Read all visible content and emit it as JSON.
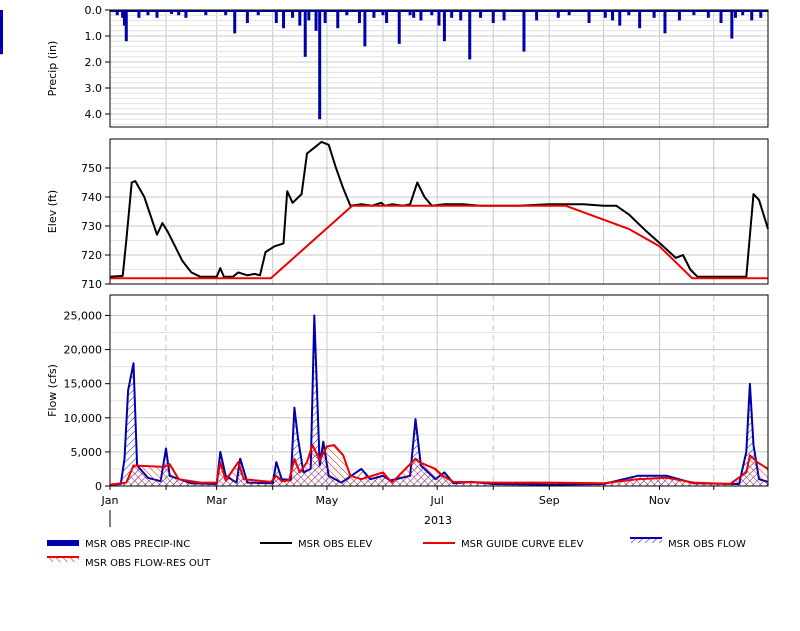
{
  "chart_data": [
    {
      "type": "bar",
      "ylabel": "Precip (in)",
      "ylim": [
        0,
        4.5
      ],
      "y_inverted": true,
      "yticks": [
        "0.0",
        "1.0",
        "2.0",
        "3.0",
        "4.0"
      ],
      "grid": true,
      "color": "#0000aa",
      "series_name": "MSR OBS PRECIP-INC",
      "x": [
        "2013-01-05",
        "2013-01-08",
        "2013-01-09",
        "2013-01-10",
        "2013-01-17",
        "2013-01-22",
        "2013-01-27",
        "2013-02-04",
        "2013-02-08",
        "2013-02-12",
        "2013-02-23",
        "2013-03-06",
        "2013-03-11",
        "2013-03-18",
        "2013-03-24",
        "2013-04-03",
        "2013-04-07",
        "2013-04-12",
        "2013-04-16",
        "2013-04-19",
        "2013-04-21",
        "2013-04-25",
        "2013-04-27",
        "2013-04-30",
        "2013-05-07",
        "2013-05-12",
        "2013-05-19",
        "2013-05-22",
        "2013-05-27",
        "2013-06-01",
        "2013-06-03",
        "2013-06-10",
        "2013-06-16",
        "2013-06-18",
        "2013-06-22",
        "2013-06-28",
        "2013-07-02",
        "2013-07-05",
        "2013-07-09",
        "2013-07-14",
        "2013-07-19",
        "2013-07-25",
        "2013-08-01",
        "2013-08-07",
        "2013-08-18",
        "2013-08-25",
        "2013-09-06",
        "2013-09-12",
        "2013-09-23",
        "2013-10-02",
        "2013-10-06",
        "2013-10-10",
        "2013-10-15",
        "2013-10-21",
        "2013-10-29",
        "2013-11-04",
        "2013-11-12",
        "2013-11-20",
        "2013-11-28",
        "2013-12-05",
        "2013-12-11",
        "2013-12-13",
        "2013-12-17",
        "2013-12-22",
        "2013-12-27"
      ],
      "values": [
        0.2,
        0.3,
        0.6,
        1.2,
        0.3,
        0.2,
        0.3,
        0.15,
        0.2,
        0.3,
        0.2,
        0.2,
        0.9,
        0.5,
        0.2,
        0.5,
        0.7,
        0.3,
        0.6,
        1.8,
        0.4,
        0.8,
        4.2,
        0.5,
        0.7,
        0.2,
        0.5,
        1.4,
        0.3,
        0.2,
        0.5,
        1.3,
        0.2,
        0.3,
        0.4,
        0.2,
        0.6,
        1.2,
        0.3,
        0.4,
        1.9,
        0.3,
        0.5,
        0.4,
        1.6,
        0.4,
        0.3,
        0.2,
        0.5,
        0.3,
        0.4,
        0.6,
        0.2,
        0.7,
        0.3,
        0.9,
        0.4,
        0.2,
        0.3,
        0.5,
        1.1,
        0.3,
        0.2,
        0.4,
        0.3,
        0.2,
        0.3,
        0.2,
        0.2,
        1.7,
        0.3,
        0.2
      ]
    },
    {
      "type": "line",
      "ylabel": "Elev (ft)",
      "ylim": [
        710,
        760
      ],
      "yticks": [
        "710",
        "720",
        "730",
        "740",
        "750"
      ],
      "grid": true,
      "series": [
        {
          "name": "MSR OBS ELEV",
          "color": "#000000",
          "points": [
            [
              "2013-01-01",
              712.5
            ],
            [
              "2013-01-08",
              712.8
            ],
            [
              "2013-01-10",
              725
            ],
            [
              "2013-01-13",
              745
            ],
            [
              "2013-01-15",
              745.5
            ],
            [
              "2013-01-20",
              740
            ],
            [
              "2013-01-27",
              727
            ],
            [
              "2013-01-30",
              731
            ],
            [
              "2013-02-02",
              728
            ],
            [
              "2013-02-10",
              718
            ],
            [
              "2013-02-15",
              714
            ],
            [
              "2013-02-20",
              712.5
            ],
            [
              "2013-03-01",
              712.5
            ],
            [
              "2013-03-03",
              715.5
            ],
            [
              "2013-03-05",
              712.5
            ],
            [
              "2013-03-10",
              712.5
            ],
            [
              "2013-03-13",
              714
            ],
            [
              "2013-03-18",
              713
            ],
            [
              "2013-03-22",
              713.5
            ],
            [
              "2013-03-25",
              713
            ],
            [
              "2013-03-28",
              721
            ],
            [
              "2013-04-02",
              723
            ],
            [
              "2013-04-07",
              724
            ],
            [
              "2013-04-09",
              742
            ],
            [
              "2013-04-12",
              738
            ],
            [
              "2013-04-17",
              741
            ],
            [
              "2013-04-20",
              755
            ],
            [
              "2013-04-24",
              757
            ],
            [
              "2013-04-28",
              759
            ],
            [
              "2013-05-02",
              758
            ],
            [
              "2013-05-06",
              750
            ],
            [
              "2013-05-10",
              743
            ],
            [
              "2013-05-14",
              737
            ],
            [
              "2013-05-20",
              737.5
            ],
            [
              "2013-05-26",
              737
            ],
            [
              "2013-05-31",
              738
            ],
            [
              "2013-06-02",
              737
            ],
            [
              "2013-06-06",
              737.5
            ],
            [
              "2013-06-12",
              737
            ],
            [
              "2013-06-16",
              737.5
            ],
            [
              "2013-06-20",
              745
            ],
            [
              "2013-06-24",
              740
            ],
            [
              "2013-06-28",
              737
            ],
            [
              "2013-07-05",
              737.5
            ],
            [
              "2013-07-15",
              737.5
            ],
            [
              "2013-07-25",
              737
            ],
            [
              "2013-08-15",
              737
            ],
            [
              "2013-09-01",
              737.5
            ],
            [
              "2013-09-20",
              737.5
            ],
            [
              "2013-10-01",
              737
            ],
            [
              "2013-10-08",
              737
            ],
            [
              "2013-10-15",
              734
            ],
            [
              "2013-10-25",
              728
            ],
            [
              "2013-11-03",
              723
            ],
            [
              "2013-11-10",
              719
            ],
            [
              "2013-11-14",
              720
            ],
            [
              "2013-11-18",
              715
            ],
            [
              "2013-11-22",
              712.5
            ],
            [
              "2013-12-05",
              712.5
            ],
            [
              "2013-12-19",
              712.5
            ],
            [
              "2013-12-23",
              741
            ],
            [
              "2013-12-26",
              739
            ],
            [
              "2013-12-31",
              729
            ]
          ]
        },
        {
          "name": "MSR GUIDE CURVE ELEV",
          "color": "#ee0000",
          "points": [
            [
              "2013-01-01",
              712
            ],
            [
              "2013-03-31",
              712
            ],
            [
              "2013-05-15",
              737
            ],
            [
              "2013-09-10",
              737
            ],
            [
              "2013-10-15",
              729
            ],
            [
              "2013-11-01",
              723
            ],
            [
              "2013-11-19",
              712
            ],
            [
              "2013-12-31",
              712
            ]
          ]
        }
      ]
    },
    {
      "type": "line",
      "ylabel": "Flow (cfs)",
      "ylim": [
        0,
        28000
      ],
      "yticks": [
        "0",
        "5,000",
        "10,000",
        "15,000",
        "20,000",
        "25,000"
      ],
      "grid": true,
      "xaxis": {
        "tick_labels": [
          "Jan",
          "Mar",
          "May",
          "Jul",
          "Sep",
          "Nov"
        ],
        "year_label": "2013"
      },
      "series": [
        {
          "name": "MSR OBS FLOW",
          "color": "#0000aa",
          "points": [
            [
              "2013-01-01",
              200
            ],
            [
              "2013-01-07",
              300
            ],
            [
              "2013-01-09",
              4000
            ],
            [
              "2013-01-11",
              14000
            ],
            [
              "2013-01-14",
              18000
            ],
            [
              "2013-01-16",
              3000
            ],
            [
              "2013-01-22",
              1200
            ],
            [
              "2013-01-29",
              700
            ],
            [
              "2013-02-01",
              5500
            ],
            [
              "2013-02-03",
              1500
            ],
            [
              "2013-02-15",
              400
            ],
            [
              "2013-03-01",
              300
            ],
            [
              "2013-03-03",
              5000
            ],
            [
              "2013-03-06",
              1500
            ],
            [
              "2013-03-12",
              500
            ],
            [
              "2013-03-14",
              4000
            ],
            [
              "2013-03-18",
              500
            ],
            [
              "2013-04-01",
              400
            ],
            [
              "2013-04-03",
              3500
            ],
            [
              "2013-04-06",
              1000
            ],
            [
              "2013-04-11",
              900
            ],
            [
              "2013-04-13",
              11500
            ],
            [
              "2013-04-15",
              7000
            ],
            [
              "2013-04-18",
              2000
            ],
            [
              "2013-04-22",
              2500
            ],
            [
              "2013-04-24",
              25000
            ],
            [
              "2013-04-27",
              3000
            ],
            [
              "2013-04-29",
              6500
            ],
            [
              "2013-05-02",
              1500
            ],
            [
              "2013-05-09",
              500
            ],
            [
              "2013-05-20",
              2500
            ],
            [
              "2013-05-25",
              1000
            ],
            [
              "2013-06-01",
              1500
            ],
            [
              "2013-06-05",
              800
            ],
            [
              "2013-06-16",
              1500
            ],
            [
              "2013-06-19",
              9800
            ],
            [
              "2013-06-22",
              3000
            ],
            [
              "2013-06-30",
              1000
            ],
            [
              "2013-07-05",
              2000
            ],
            [
              "2013-07-10",
              400
            ],
            [
              "2013-07-20",
              600
            ],
            [
              "2013-08-01",
              300
            ],
            [
              "2013-09-01",
              200
            ],
            [
              "2013-10-01",
              300
            ],
            [
              "2013-10-20",
              1500
            ],
            [
              "2013-11-05",
              1500
            ],
            [
              "2013-11-20",
              400
            ],
            [
              "2013-12-15",
              300
            ],
            [
              "2013-12-19",
              5000
            ],
            [
              "2013-12-21",
              15000
            ],
            [
              "2013-12-23",
              6000
            ],
            [
              "2013-12-26",
              1000
            ],
            [
              "2013-12-31",
              600
            ]
          ]
        },
        {
          "name": "MSR OBS FLOW-RES OUT",
          "color": "#ee0000",
          "points": [
            [
              "2013-01-01",
              200
            ],
            [
              "2013-01-10",
              500
            ],
            [
              "2013-01-14",
              3000
            ],
            [
              "2013-01-31",
              2800
            ],
            [
              "2013-02-03",
              3200
            ],
            [
              "2013-02-08",
              1000
            ],
            [
              "2013-02-20",
              500
            ],
            [
              "2013-03-01",
              500
            ],
            [
              "2013-03-03",
              3500
            ],
            [
              "2013-03-06",
              800
            ],
            [
              "2013-03-13",
              3500
            ],
            [
              "2013-03-16",
              1000
            ],
            [
              "2013-03-31",
              600
            ],
            [
              "2013-04-03",
              1500
            ],
            [
              "2013-04-06",
              700
            ],
            [
              "2013-04-10",
              800
            ],
            [
              "2013-04-13",
              4000
            ],
            [
              "2013-04-16",
              2000
            ],
            [
              "2013-04-20",
              3500
            ],
            [
              "2013-04-23",
              6000
            ],
            [
              "2013-04-27",
              3800
            ],
            [
              "2013-05-01",
              5800
            ],
            [
              "2013-05-05",
              6000
            ],
            [
              "2013-05-10",
              4500
            ],
            [
              "2013-05-14",
              1500
            ],
            [
              "2013-05-20",
              1000
            ],
            [
              "2013-06-01",
              2000
            ],
            [
              "2013-06-06",
              500
            ],
            [
              "2013-06-19",
              4000
            ],
            [
              "2013-06-21",
              3500
            ],
            [
              "2013-06-30",
              2500
            ],
            [
              "2013-07-04",
              1500
            ],
            [
              "2013-07-10",
              600
            ],
            [
              "2013-08-01",
              500
            ],
            [
              "2013-09-01",
              500
            ],
            [
              "2013-10-01",
              400
            ],
            [
              "2013-10-20",
              1000
            ],
            [
              "2013-11-05",
              1200
            ],
            [
              "2013-11-20",
              500
            ],
            [
              "2013-12-10",
              300
            ],
            [
              "2013-12-19",
              2000
            ],
            [
              "2013-12-21",
              4500
            ],
            [
              "2013-12-25",
              3500
            ],
            [
              "2013-12-31",
              2500
            ]
          ]
        }
      ]
    }
  ],
  "legend": [
    {
      "label": "MSR OBS PRECIP-INC",
      "color": "#0000aa",
      "style": "thick-bar"
    },
    {
      "label": "MSR OBS ELEV",
      "color": "#000000",
      "style": "line"
    },
    {
      "label": "MSR GUIDE CURVE ELEV",
      "color": "#ee0000",
      "style": "line"
    },
    {
      "label": "MSR OBS FLOW",
      "color": "#0000aa",
      "style": "hatch"
    },
    {
      "label": "MSR OBS FLOW-RES OUT",
      "color": "#ee0000",
      "style": "hatch"
    }
  ]
}
